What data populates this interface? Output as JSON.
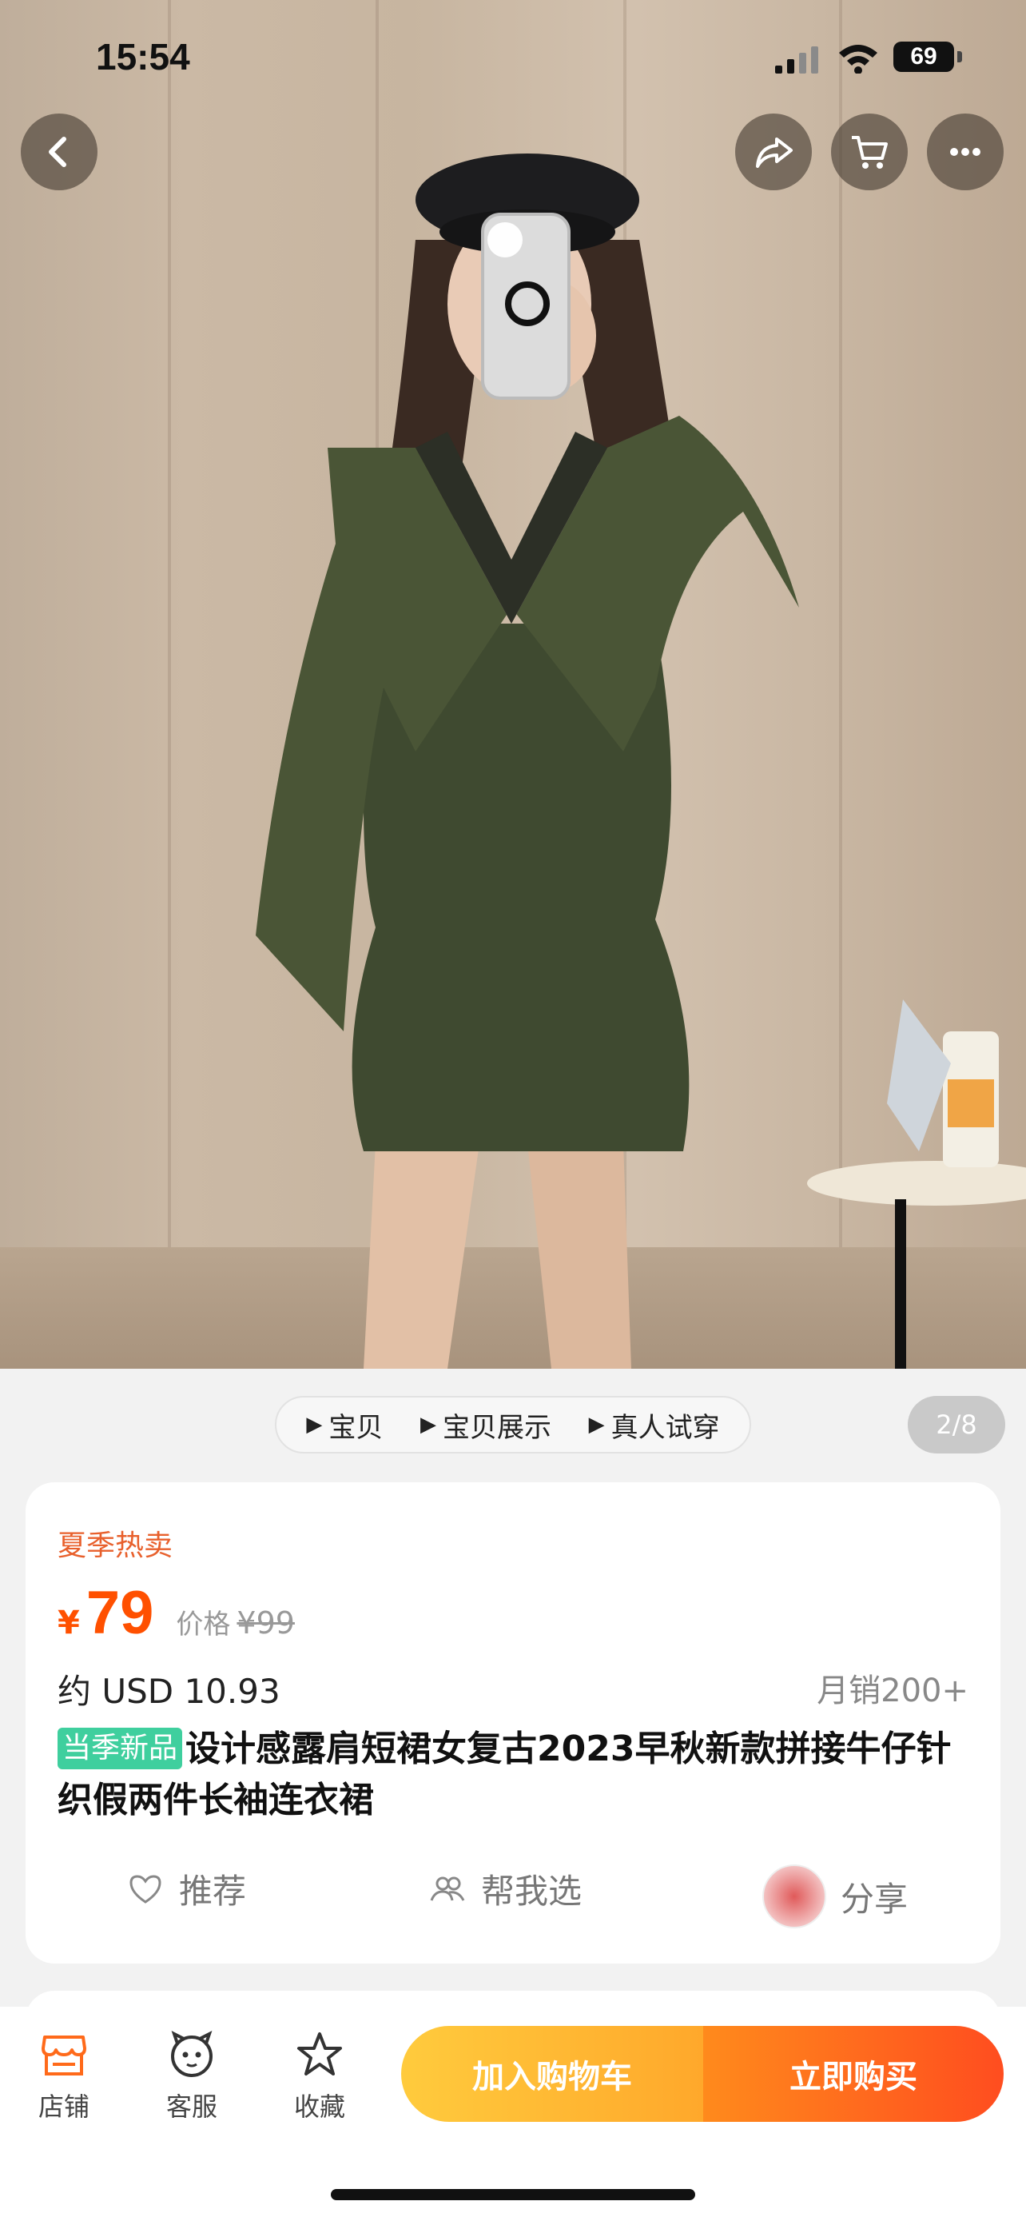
{
  "status_bar": {
    "time": "15:54",
    "battery": "69"
  },
  "header": {
    "back_icon": "chevron-left-icon",
    "share_icon": "share-arrow-icon",
    "cart_icon": "cart-icon",
    "more_icon": "ellipsis-icon"
  },
  "gallery": {
    "tabs": [
      {
        "label": "宝贝"
      },
      {
        "label": "宝贝展示"
      },
      {
        "label": "真人试穿"
      }
    ],
    "counter": "2/8"
  },
  "product": {
    "promo_tag": "夏季热卖",
    "currency": "¥",
    "price": "79",
    "original_price_label": "价格",
    "original_price": "¥99",
    "usd_price": "约 USD 10.93",
    "monthly_sales": "月销200+",
    "new_tag": "当季新品",
    "title": "设计感露肩短裙女复古2023早秋新款拼接牛仔针织假两件长袖连衣裙"
  },
  "actions": [
    {
      "label": "推荐",
      "icon": "heart-icon"
    },
    {
      "label": "帮我选",
      "icon": "people-icon"
    },
    {
      "label": "分享",
      "icon": "avatar-icon"
    }
  ],
  "bottom_bar": {
    "store_label": "店铺",
    "service_label": "客服",
    "favorite_label": "收藏",
    "add_to_cart_label": "加入购物车",
    "buy_now_label": "立即购买"
  },
  "colors": {
    "accent_orange": "#ff5000",
    "new_tag_green": "#3fcf9e",
    "cart_button": "#ffb830",
    "buy_button": "#ff5a1f"
  }
}
